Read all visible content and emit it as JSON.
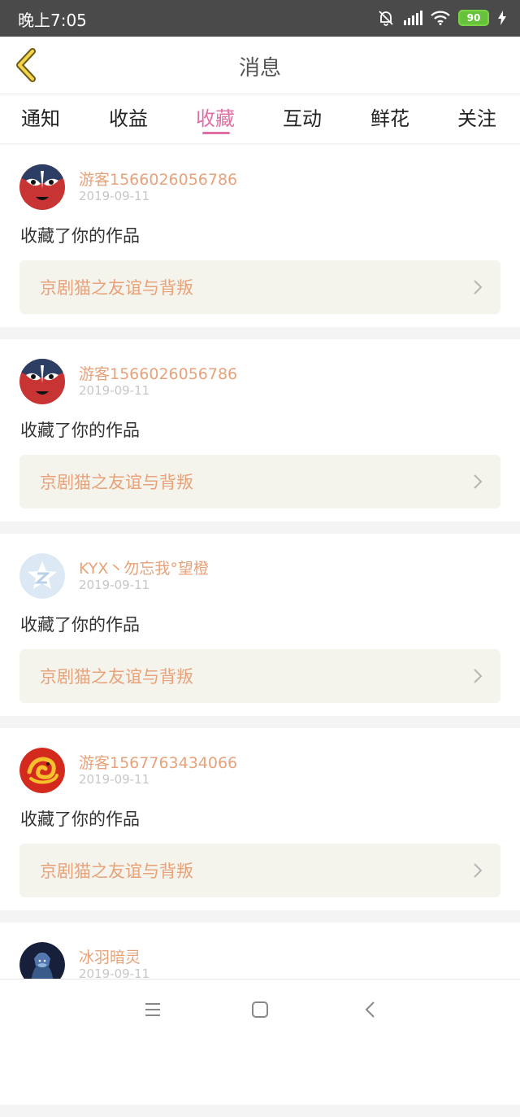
{
  "status": {
    "time": "晚上7:05",
    "battery": "90"
  },
  "header": {
    "title": "消息"
  },
  "tabs": [
    {
      "label": "通知"
    },
    {
      "label": "收益"
    },
    {
      "label": "收藏"
    },
    {
      "label": "互动"
    },
    {
      "label": "鲜花"
    },
    {
      "label": "关注"
    }
  ],
  "active_tab": "收藏",
  "items": [
    {
      "username": "游客1566026056786",
      "date": "2019-09-11",
      "action": "收藏了你的作品",
      "work": "京剧猫之友谊与背叛"
    },
    {
      "username": "游客1566026056786",
      "date": "2019-09-11",
      "action": "收藏了你的作品",
      "work": "京剧猫之友谊与背叛"
    },
    {
      "username": "KYX丶勿忘我°望橙",
      "date": "2019-09-11",
      "action": "收藏了你的作品",
      "work": "京剧猫之友谊与背叛"
    },
    {
      "username": "游客1567763434066",
      "date": "2019-09-11",
      "action": "收藏了你的作品",
      "work": "京剧猫之友谊与背叛"
    },
    {
      "username": "冰羽暗灵",
      "date": "2019-09-11"
    }
  ],
  "colors": {
    "accent": "#e06fa4",
    "username": "#e8a27a",
    "work_bg": "#f5f4ec"
  }
}
